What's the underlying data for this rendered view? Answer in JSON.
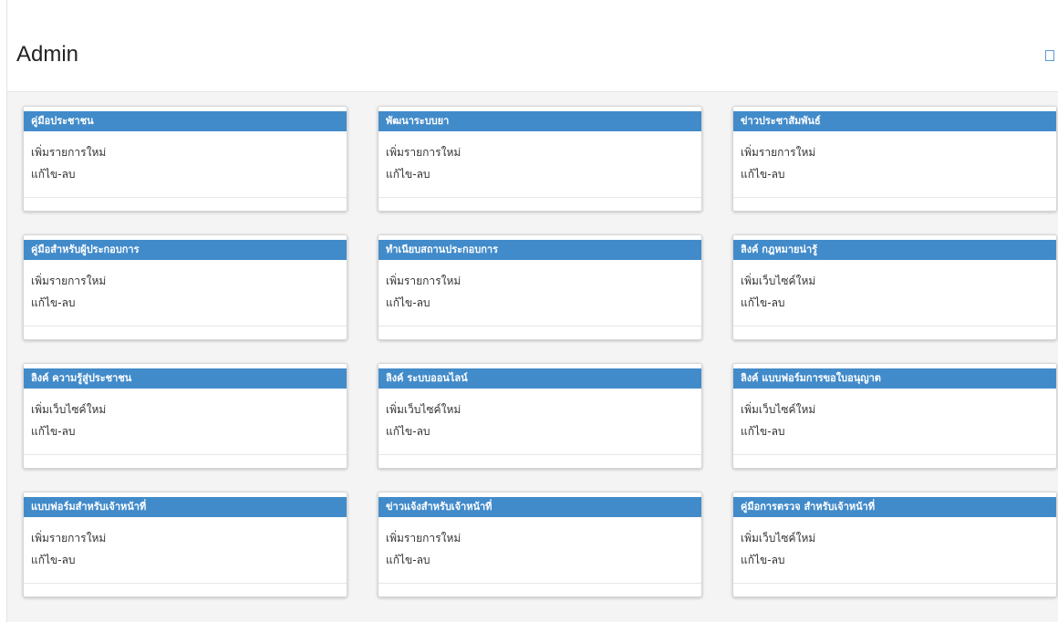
{
  "header": {
    "title": "Admin",
    "toggle_icon": "square-outline-icon"
  },
  "colors": {
    "card_header": "#428bca",
    "content_background": "#f4f4f4"
  },
  "cards": [
    {
      "title": "คู่มือประชาชน",
      "links": [
        "เพิ่มรายการใหม่",
        "แก้ไข-ลบ"
      ]
    },
    {
      "title": "พัฒนาระบบยา",
      "links": [
        "เพิ่มรายการใหม่",
        "แก้ไข-ลบ"
      ]
    },
    {
      "title": "ข่าวประชาสัมพันธ์",
      "links": [
        "เพิ่มรายการใหม่",
        "แก้ไข-ลบ"
      ]
    },
    {
      "title": "คู่มือสำหรับผู้ประกอบการ",
      "links": [
        "เพิ่มรายการใหม่",
        "แก้ไข-ลบ"
      ]
    },
    {
      "title": "ทำเนียบสถานประกอบการ",
      "links": [
        "เพิ่มรายการใหม่",
        "แก้ไข-ลบ"
      ]
    },
    {
      "title": "ลิงค์ กฎหมายน่ารู้",
      "links": [
        "เพิ่มเว็บไซค์ใหม่",
        "แก้ไข-ลบ"
      ]
    },
    {
      "title": "ลิงค์ ความรู้สู่ประชาชน",
      "links": [
        "เพิ่มเว็บไซค์ใหม่",
        "แก้ไข-ลบ"
      ]
    },
    {
      "title": "ลิงค์ ระบบออนไลน์",
      "links": [
        "เพิ่มเว็บไซค์ใหม่",
        "แก้ไข-ลบ"
      ]
    },
    {
      "title": "ลิงค์ แบบฟอร์มการขอใบอนุญาต",
      "links": [
        "เพิ่มเว็บไซค์ใหม่",
        "แก้ไข-ลบ"
      ]
    },
    {
      "title": "แบบฟอร์มสำหรับเจ้าหน้าที่",
      "links": [
        "เพิ่มรายการใหม่",
        "แก้ไข-ลบ"
      ]
    },
    {
      "title": "ข่าวแจ้งสำหรับเจ้าหน้าที่",
      "links": [
        "เพิ่มรายการใหม่",
        "แก้ไข-ลบ"
      ]
    },
    {
      "title": "คู่มือการตรวจ สำหรับเจ้าหน้าที่",
      "links": [
        "เพิ่มเว็บไซค์ใหม่",
        "แก้ไข-ลบ"
      ]
    }
  ]
}
